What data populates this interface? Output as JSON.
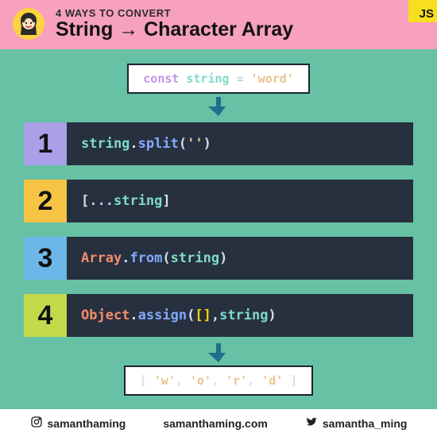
{
  "header": {
    "eyebrow": "4 WAYS TO CONVERT",
    "title": "String → Character Array",
    "badge": "JS"
  },
  "input": {
    "kw": "const",
    "var": "string",
    "op": " = ",
    "str": "'word'"
  },
  "ways": [
    {
      "num": "1",
      "segments": [
        {
          "cls": "t-var",
          "t": "string"
        },
        {
          "cls": "t-pun",
          "t": "."
        },
        {
          "cls": "t-fn",
          "t": "split"
        },
        {
          "cls": "t-pun",
          "t": "("
        },
        {
          "cls": "t-str",
          "t": "''"
        },
        {
          "cls": "t-pun",
          "t": ")"
        }
      ]
    },
    {
      "num": "2",
      "segments": [
        {
          "cls": "t-pun",
          "t": "["
        },
        {
          "cls": "t-op",
          "t": "..."
        },
        {
          "cls": "t-var",
          "t": "string"
        },
        {
          "cls": "t-pun",
          "t": "]"
        }
      ]
    },
    {
      "num": "3",
      "segments": [
        {
          "cls": "t-obj",
          "t": "Array"
        },
        {
          "cls": "t-pun",
          "t": "."
        },
        {
          "cls": "t-fn",
          "t": "from"
        },
        {
          "cls": "t-pun",
          "t": "("
        },
        {
          "cls": "t-var",
          "t": "string"
        },
        {
          "cls": "t-pun",
          "t": ")"
        }
      ]
    },
    {
      "num": "4",
      "segments": [
        {
          "cls": "t-obj",
          "t": "Object"
        },
        {
          "cls": "t-pun",
          "t": "."
        },
        {
          "cls": "t-fn",
          "t": "assign"
        },
        {
          "cls": "t-pun",
          "t": "("
        },
        {
          "cls": "t-brk",
          "t": "[]"
        },
        {
          "cls": "t-pun",
          "t": ", "
        },
        {
          "cls": "t-var",
          "t": "string"
        },
        {
          "cls": "t-pun",
          "t": ")"
        }
      ]
    }
  ],
  "output": {
    "segments": [
      {
        "cls": "t-pun",
        "t": "[ "
      },
      {
        "cls": "t-str",
        "t": "'w'"
      },
      {
        "cls": "t-pun",
        "t": ", "
      },
      {
        "cls": "t-str",
        "t": "'o'"
      },
      {
        "cls": "t-pun",
        "t": ", "
      },
      {
        "cls": "t-str",
        "t": "'r'"
      },
      {
        "cls": "t-pun",
        "t": ", "
      },
      {
        "cls": "t-str",
        "t": "'d'"
      },
      {
        "cls": "t-pun",
        "t": " ]"
      }
    ]
  },
  "footer": {
    "instagram": "samanthaming",
    "site": "samanthaming.com",
    "twitter": "samantha_ming"
  }
}
